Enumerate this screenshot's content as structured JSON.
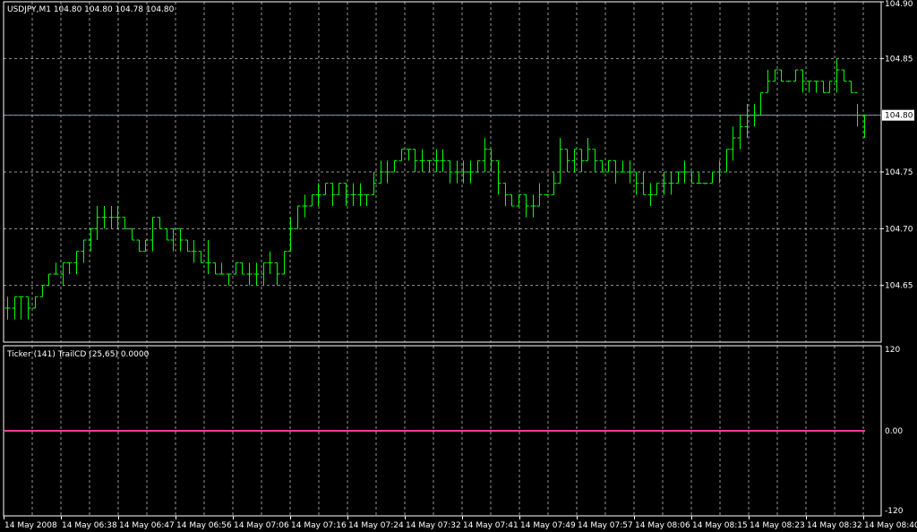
{
  "main_panel": {
    "header": "USDJPY,M1  104.80 104.80 104.78 104.80",
    "y_ticks": [
      "104.90",
      "104.85",
      "104.80",
      "104.75",
      "104.70",
      "104.65"
    ],
    "current_price": "104.80"
  },
  "indicator_panel": {
    "header": "Ticker (141) TrailCD (25,65) 0.0000",
    "y_ticks": [
      "120",
      "0.00",
      "-120"
    ]
  },
  "x_ticks": [
    "14 May 2008",
    "14 May 06:38",
    "14 May 06:47",
    "14 May 06:56",
    "14 May 07:06",
    "14 May 07:16",
    "14 May 07:24",
    "14 May 07:32",
    "14 May 07:41",
    "14 May 07:49",
    "14 May 07:57",
    "14 May 08:06",
    "14 May 08:15",
    "14 May 08:23",
    "14 May 08:32",
    "14 May 08:40"
  ],
  "colors": {
    "background": "#000000",
    "bars": "#00ff00",
    "grid": "#c8c8c8",
    "frame": "#ffffff",
    "price_line": "#8090a8",
    "indicator_line": "#ff3aa0"
  },
  "chart_data": {
    "type": "ohlc",
    "symbol": "USDJPY",
    "timeframe": "M1",
    "ylim": [
      104.6,
      104.9
    ],
    "indicator": {
      "name": "TrailCD",
      "ylim": [
        -120,
        120
      ],
      "value": 0
    },
    "bars": [
      {
        "o": 104.63,
        "h": 104.64,
        "l": 104.62,
        "c": 104.63
      },
      {
        "o": 104.63,
        "h": 104.64,
        "l": 104.62,
        "c": 104.64
      },
      {
        "o": 104.64,
        "h": 104.64,
        "l": 104.62,
        "c": 104.64
      },
      {
        "o": 104.64,
        "h": 104.64,
        "l": 104.62,
        "c": 104.63
      },
      {
        "o": 104.63,
        "h": 104.64,
        "l": 104.63,
        "c": 104.64
      },
      {
        "o": 104.64,
        "h": 104.65,
        "l": 104.64,
        "c": 104.65
      },
      {
        "o": 104.65,
        "h": 104.66,
        "l": 104.65,
        "c": 104.66
      },
      {
        "o": 104.66,
        "h": 104.67,
        "l": 104.66,
        "c": 104.66
      },
      {
        "o": 104.66,
        "h": 104.67,
        "l": 104.65,
        "c": 104.67
      },
      {
        "o": 104.67,
        "h": 104.67,
        "l": 104.66,
        "c": 104.67
      },
      {
        "o": 104.67,
        "h": 104.68,
        "l": 104.66,
        "c": 104.68
      },
      {
        "o": 104.68,
        "h": 104.69,
        "l": 104.67,
        "c": 104.69
      },
      {
        "o": 104.69,
        "h": 104.7,
        "l": 104.68,
        "c": 104.7
      },
      {
        "o": 104.7,
        "h": 104.72,
        "l": 104.69,
        "c": 104.71
      },
      {
        "o": 104.71,
        "h": 104.72,
        "l": 104.7,
        "c": 104.71
      },
      {
        "o": 104.71,
        "h": 104.72,
        "l": 104.7,
        "c": 104.71
      },
      {
        "o": 104.71,
        "h": 104.72,
        "l": 104.7,
        "c": 104.71
      },
      {
        "o": 104.71,
        "h": 104.71,
        "l": 104.7,
        "c": 104.7
      },
      {
        "o": 104.7,
        "h": 104.7,
        "l": 104.69,
        "c": 104.69
      },
      {
        "o": 104.69,
        "h": 104.69,
        "l": 104.68,
        "c": 104.68
      },
      {
        "o": 104.68,
        "h": 104.69,
        "l": 104.68,
        "c": 104.69
      },
      {
        "o": 104.69,
        "h": 104.71,
        "l": 104.68,
        "c": 104.71
      },
      {
        "o": 104.71,
        "h": 104.71,
        "l": 104.7,
        "c": 104.7
      },
      {
        "o": 104.7,
        "h": 104.7,
        "l": 104.69,
        "c": 104.69
      },
      {
        "o": 104.69,
        "h": 104.7,
        "l": 104.68,
        "c": 104.7
      },
      {
        "o": 104.7,
        "h": 104.7,
        "l": 104.68,
        "c": 104.69
      },
      {
        "o": 104.69,
        "h": 104.69,
        "l": 104.68,
        "c": 104.68
      },
      {
        "o": 104.68,
        "h": 104.69,
        "l": 104.67,
        "c": 104.68
      },
      {
        "o": 104.68,
        "h": 104.68,
        "l": 104.67,
        "c": 104.67
      },
      {
        "o": 104.67,
        "h": 104.69,
        "l": 104.66,
        "c": 104.67
      },
      {
        "o": 104.67,
        "h": 104.67,
        "l": 104.66,
        "c": 104.66
      },
      {
        "o": 104.66,
        "h": 104.67,
        "l": 104.66,
        "c": 104.66
      },
      {
        "o": 104.66,
        "h": 104.66,
        "l": 104.65,
        "c": 104.66
      },
      {
        "o": 104.66,
        "h": 104.67,
        "l": 104.66,
        "c": 104.67
      },
      {
        "o": 104.67,
        "h": 104.67,
        "l": 104.66,
        "c": 104.66
      },
      {
        "o": 104.66,
        "h": 104.67,
        "l": 104.65,
        "c": 104.66
      },
      {
        "o": 104.66,
        "h": 104.67,
        "l": 104.65,
        "c": 104.66
      },
      {
        "o": 104.66,
        "h": 104.67,
        "l": 104.65,
        "c": 104.67
      },
      {
        "o": 104.67,
        "h": 104.68,
        "l": 104.66,
        "c": 104.67
      },
      {
        "o": 104.67,
        "h": 104.67,
        "l": 104.65,
        "c": 104.66
      },
      {
        "o": 104.66,
        "h": 104.68,
        "l": 104.66,
        "c": 104.68
      },
      {
        "o": 104.68,
        "h": 104.71,
        "l": 104.68,
        "c": 104.7
      },
      {
        "o": 104.7,
        "h": 104.72,
        "l": 104.7,
        "c": 104.72
      },
      {
        "o": 104.72,
        "h": 104.73,
        "l": 104.71,
        "c": 104.72
      },
      {
        "o": 104.72,
        "h": 104.73,
        "l": 104.72,
        "c": 104.73
      },
      {
        "o": 104.73,
        "h": 104.74,
        "l": 104.72,
        "c": 104.73
      },
      {
        "o": 104.73,
        "h": 104.74,
        "l": 104.73,
        "c": 104.74
      },
      {
        "o": 104.74,
        "h": 104.74,
        "l": 104.72,
        "c": 104.73
      },
      {
        "o": 104.73,
        "h": 104.74,
        "l": 104.73,
        "c": 104.74
      },
      {
        "o": 104.74,
        "h": 104.74,
        "l": 104.72,
        "c": 104.73
      },
      {
        "o": 104.73,
        "h": 104.74,
        "l": 104.72,
        "c": 104.73
      },
      {
        "o": 104.73,
        "h": 104.74,
        "l": 104.72,
        "c": 104.73
      },
      {
        "o": 104.73,
        "h": 104.73,
        "l": 104.72,
        "c": 104.73
      },
      {
        "o": 104.73,
        "h": 104.75,
        "l": 104.73,
        "c": 104.74
      },
      {
        "o": 104.74,
        "h": 104.76,
        "l": 104.74,
        "c": 104.75
      },
      {
        "o": 104.75,
        "h": 104.76,
        "l": 104.74,
        "c": 104.75
      },
      {
        "o": 104.75,
        "h": 104.76,
        "l": 104.75,
        "c": 104.76
      },
      {
        "o": 104.76,
        "h": 104.77,
        "l": 104.76,
        "c": 104.77
      },
      {
        "o": 104.77,
        "h": 104.77,
        "l": 104.76,
        "c": 104.77
      },
      {
        "o": 104.77,
        "h": 104.77,
        "l": 104.75,
        "c": 104.76
      },
      {
        "o": 104.76,
        "h": 104.77,
        "l": 104.75,
        "c": 104.76
      },
      {
        "o": 104.76,
        "h": 104.76,
        "l": 104.75,
        "c": 104.76
      },
      {
        "o": 104.76,
        "h": 104.77,
        "l": 104.75,
        "c": 104.76
      },
      {
        "o": 104.76,
        "h": 104.77,
        "l": 104.75,
        "c": 104.76
      },
      {
        "o": 104.76,
        "h": 104.76,
        "l": 104.74,
        "c": 104.75
      },
      {
        "o": 104.75,
        "h": 104.76,
        "l": 104.74,
        "c": 104.75
      },
      {
        "o": 104.75,
        "h": 104.76,
        "l": 104.74,
        "c": 104.75
      },
      {
        "o": 104.75,
        "h": 104.76,
        "l": 104.74,
        "c": 104.75
      },
      {
        "o": 104.75,
        "h": 104.76,
        "l": 104.75,
        "c": 104.76
      },
      {
        "o": 104.76,
        "h": 104.78,
        "l": 104.75,
        "c": 104.77
      },
      {
        "o": 104.77,
        "h": 104.77,
        "l": 104.75,
        "c": 104.76
      },
      {
        "o": 104.76,
        "h": 104.76,
        "l": 104.73,
        "c": 104.74
      },
      {
        "o": 104.74,
        "h": 104.74,
        "l": 104.72,
        "c": 104.73
      },
      {
        "o": 104.73,
        "h": 104.73,
        "l": 104.72,
        "c": 104.72
      },
      {
        "o": 104.72,
        "h": 104.73,
        "l": 104.72,
        "c": 104.73
      },
      {
        "o": 104.73,
        "h": 104.73,
        "l": 104.71,
        "c": 104.72
      },
      {
        "o": 104.72,
        "h": 104.73,
        "l": 104.71,
        "c": 104.72
      },
      {
        "o": 104.72,
        "h": 104.74,
        "l": 104.72,
        "c": 104.73
      },
      {
        "o": 104.73,
        "h": 104.73,
        "l": 104.73,
        "c": 104.73
      },
      {
        "o": 104.73,
        "h": 104.75,
        "l": 104.73,
        "c": 104.74
      },
      {
        "o": 104.74,
        "h": 104.78,
        "l": 104.74,
        "c": 104.77
      },
      {
        "o": 104.77,
        "h": 104.77,
        "l": 104.75,
        "c": 104.76
      },
      {
        "o": 104.76,
        "h": 104.77,
        "l": 104.75,
        "c": 104.77
      },
      {
        "o": 104.77,
        "h": 104.77,
        "l": 104.75,
        "c": 104.76
      },
      {
        "o": 104.76,
        "h": 104.78,
        "l": 104.76,
        "c": 104.77
      },
      {
        "o": 104.77,
        "h": 104.77,
        "l": 104.75,
        "c": 104.76
      },
      {
        "o": 104.76,
        "h": 104.76,
        "l": 104.75,
        "c": 104.75
      },
      {
        "o": 104.75,
        "h": 104.76,
        "l": 104.75,
        "c": 104.76
      },
      {
        "o": 104.76,
        "h": 104.76,
        "l": 104.74,
        "c": 104.75
      },
      {
        "o": 104.75,
        "h": 104.76,
        "l": 104.75,
        "c": 104.75
      },
      {
        "o": 104.75,
        "h": 104.76,
        "l": 104.74,
        "c": 104.75
      },
      {
        "o": 104.75,
        "h": 104.75,
        "l": 104.73,
        "c": 104.74
      },
      {
        "o": 104.74,
        "h": 104.75,
        "l": 104.73,
        "c": 104.73
      },
      {
        "o": 104.73,
        "h": 104.74,
        "l": 104.72,
        "c": 104.73
      },
      {
        "o": 104.73,
        "h": 104.74,
        "l": 104.73,
        "c": 104.74
      },
      {
        "o": 104.74,
        "h": 104.75,
        "l": 104.73,
        "c": 104.74
      },
      {
        "o": 104.74,
        "h": 104.75,
        "l": 104.73,
        "c": 104.74
      },
      {
        "o": 104.74,
        "h": 104.75,
        "l": 104.74,
        "c": 104.75
      },
      {
        "o": 104.75,
        "h": 104.76,
        "l": 104.74,
        "c": 104.75
      },
      {
        "o": 104.75,
        "h": 104.75,
        "l": 104.74,
        "c": 104.74
      },
      {
        "o": 104.74,
        "h": 104.75,
        "l": 104.74,
        "c": 104.74
      },
      {
        "o": 104.74,
        "h": 104.74,
        "l": 104.74,
        "c": 104.74
      },
      {
        "o": 104.74,
        "h": 104.75,
        "l": 104.74,
        "c": 104.75
      },
      {
        "o": 104.75,
        "h": 104.76,
        "l": 104.74,
        "c": 104.75
      },
      {
        "o": 104.75,
        "h": 104.77,
        "l": 104.75,
        "c": 104.77
      },
      {
        "o": 104.77,
        "h": 104.79,
        "l": 104.76,
        "c": 104.78
      },
      {
        "o": 104.78,
        "h": 104.8,
        "l": 104.77,
        "c": 104.79
      },
      {
        "o": 104.79,
        "h": 104.81,
        "l": 104.78,
        "c": 104.8
      },
      {
        "o": 104.8,
        "h": 104.81,
        "l": 104.79,
        "c": 104.8
      },
      {
        "o": 104.8,
        "h": 104.82,
        "l": 104.8,
        "c": 104.82
      },
      {
        "o": 104.82,
        "h": 104.84,
        "l": 104.82,
        "c": 104.83
      },
      {
        "o": 104.83,
        "h": 104.84,
        "l": 104.83,
        "c": 104.84
      },
      {
        "o": 104.84,
        "h": 104.84,
        "l": 104.83,
        "c": 104.83
      },
      {
        "o": 104.83,
        "h": 104.83,
        "l": 104.83,
        "c": 104.83
      },
      {
        "o": 104.83,
        "h": 104.84,
        "l": 104.83,
        "c": 104.84
      },
      {
        "o": 104.84,
        "h": 104.84,
        "l": 104.82,
        "c": 104.83
      },
      {
        "o": 104.83,
        "h": 104.83,
        "l": 104.82,
        "c": 104.83
      },
      {
        "o": 104.83,
        "h": 104.83,
        "l": 104.82,
        "c": 104.83
      },
      {
        "o": 104.83,
        "h": 104.83,
        "l": 104.82,
        "c": 104.82
      },
      {
        "o": 104.82,
        "h": 104.83,
        "l": 104.82,
        "c": 104.83
      },
      {
        "o": 104.83,
        "h": 104.85,
        "l": 104.82,
        "c": 104.84
      },
      {
        "o": 104.84,
        "h": 104.84,
        "l": 104.83,
        "c": 104.83
      },
      {
        "o": 104.83,
        "h": 104.83,
        "l": 104.82,
        "c": 104.82
      },
      {
        "o": 104.82,
        "h": 104.81,
        "l": 104.79,
        "c": 104.8
      },
      {
        "o": 104.8,
        "h": 104.8,
        "l": 104.78,
        "c": 104.8
      }
    ]
  }
}
